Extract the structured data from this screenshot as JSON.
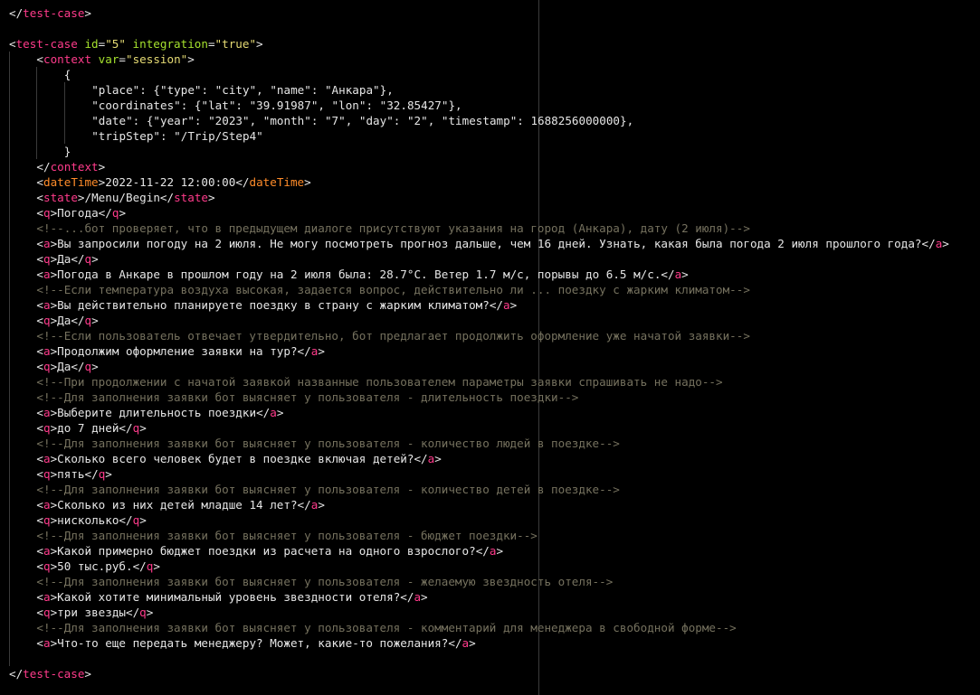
{
  "editor": {
    "colors": {
      "background": "#000000",
      "tag": "#ff3b8b",
      "element_name": "#ff8c2a",
      "attribute": "#a6e22e",
      "string": "#e6db74",
      "text": "#e6e6e6",
      "comment": "#75715e"
    },
    "lines": [
      {
        "indent": 0,
        "tokens": [
          {
            "k": "punct",
            "t": "</"
          },
          {
            "k": "tag",
            "t": "test-case"
          },
          {
            "k": "punct",
            "t": ">"
          }
        ]
      },
      {
        "indent": 0,
        "tokens": []
      },
      {
        "indent": 0,
        "tokens": [
          {
            "k": "punct",
            "t": "<"
          },
          {
            "k": "tag",
            "t": "test-case"
          },
          {
            "k": "text",
            "t": " "
          },
          {
            "k": "attr",
            "t": "id"
          },
          {
            "k": "punct",
            "t": "="
          },
          {
            "k": "str",
            "t": "\"5\""
          },
          {
            "k": "text",
            "t": " "
          },
          {
            "k": "attr",
            "t": "integration"
          },
          {
            "k": "punct",
            "t": "="
          },
          {
            "k": "str",
            "t": "\"true\""
          },
          {
            "k": "punct",
            "t": ">"
          }
        ]
      },
      {
        "indent": 1,
        "tokens": [
          {
            "k": "punct",
            "t": "<"
          },
          {
            "k": "tag",
            "t": "context"
          },
          {
            "k": "text",
            "t": " "
          },
          {
            "k": "attr",
            "t": "var"
          },
          {
            "k": "punct",
            "t": "="
          },
          {
            "k": "str",
            "t": "\"session\""
          },
          {
            "k": "punct",
            "t": ">"
          }
        ]
      },
      {
        "indent": 2,
        "tokens": [
          {
            "k": "text",
            "t": "{"
          }
        ]
      },
      {
        "indent": 3,
        "tokens": [
          {
            "k": "text",
            "t": "\"place\": {\"type\": \"city\", \"name\": \"Анкара\"},"
          }
        ]
      },
      {
        "indent": 3,
        "tokens": [
          {
            "k": "text",
            "t": "\"coordinates\": {\"lat\": \"39.91987\", \"lon\": \"32.85427\"},"
          }
        ]
      },
      {
        "indent": 3,
        "tokens": [
          {
            "k": "text",
            "t": "\"date\": {\"year\": \"2023\", \"month\": \"7\", \"day\": \"2\", \"timestamp\": 1688256000000},"
          }
        ]
      },
      {
        "indent": 3,
        "tokens": [
          {
            "k": "text",
            "t": "\"tripStep\": \"/Trip/Step4\""
          }
        ]
      },
      {
        "indent": 2,
        "tokens": [
          {
            "k": "text",
            "t": "}"
          }
        ]
      },
      {
        "indent": 1,
        "tokens": [
          {
            "k": "punct",
            "t": "</"
          },
          {
            "k": "tag",
            "t": "context"
          },
          {
            "k": "punct",
            "t": ">"
          }
        ]
      },
      {
        "indent": 1,
        "tokens": [
          {
            "k": "punct",
            "t": "<"
          },
          {
            "k": "name",
            "t": "dateTime"
          },
          {
            "k": "punct",
            "t": ">"
          },
          {
            "k": "text",
            "t": "2022-11-22 12:00:00"
          },
          {
            "k": "punct",
            "t": "</"
          },
          {
            "k": "name",
            "t": "dateTime"
          },
          {
            "k": "punct",
            "t": ">"
          }
        ]
      },
      {
        "indent": 1,
        "tokens": [
          {
            "k": "punct",
            "t": "<"
          },
          {
            "k": "tag",
            "t": "state"
          },
          {
            "k": "punct",
            "t": ">"
          },
          {
            "k": "text",
            "t": "/Menu/Begin"
          },
          {
            "k": "punct",
            "t": "</"
          },
          {
            "k": "tag",
            "t": "state"
          },
          {
            "k": "punct",
            "t": ">"
          }
        ]
      },
      {
        "indent": 1,
        "tokens": [
          {
            "k": "punct",
            "t": "<"
          },
          {
            "k": "tag",
            "t": "q"
          },
          {
            "k": "punct",
            "t": ">"
          },
          {
            "k": "text",
            "t": "Погода"
          },
          {
            "k": "punct",
            "t": "</"
          },
          {
            "k": "tag",
            "t": "q"
          },
          {
            "k": "punct",
            "t": ">"
          }
        ]
      },
      {
        "indent": 1,
        "tokens": [
          {
            "k": "comment",
            "t": "<!--...бот проверяет, что в предыдущем диалоге присутствуют указания на город (Анкара), дату (2 июля)-->"
          }
        ]
      },
      {
        "indent": 1,
        "tokens": [
          {
            "k": "punct",
            "t": "<"
          },
          {
            "k": "tag",
            "t": "a"
          },
          {
            "k": "punct",
            "t": ">"
          },
          {
            "k": "text",
            "t": "Вы запросили погоду на 2 июля. Не могу посмотреть прогноз дальше, чем 16 дней. Узнать, какая была погода 2 июля прошлого года?"
          },
          {
            "k": "punct",
            "t": "</"
          },
          {
            "k": "tag",
            "t": "a"
          },
          {
            "k": "punct",
            "t": ">"
          }
        ]
      },
      {
        "indent": 1,
        "tokens": [
          {
            "k": "punct",
            "t": "<"
          },
          {
            "k": "tag",
            "t": "q"
          },
          {
            "k": "punct",
            "t": ">"
          },
          {
            "k": "text",
            "t": "Да"
          },
          {
            "k": "punct",
            "t": "</"
          },
          {
            "k": "tag",
            "t": "q"
          },
          {
            "k": "punct",
            "t": ">"
          }
        ]
      },
      {
        "indent": 1,
        "tokens": [
          {
            "k": "punct",
            "t": "<"
          },
          {
            "k": "tag",
            "t": "a"
          },
          {
            "k": "punct",
            "t": ">"
          },
          {
            "k": "text",
            "t": "Погода в Анкаре в прошлом году на 2 июля была: 28.7°С. Ветер 1.7 м/с, порывы до 6.5 м/с."
          },
          {
            "k": "punct",
            "t": "</"
          },
          {
            "k": "tag",
            "t": "a"
          },
          {
            "k": "punct",
            "t": ">"
          }
        ]
      },
      {
        "indent": 1,
        "tokens": [
          {
            "k": "comment",
            "t": "<!--Если температура воздуха высокая, задается вопрос, действительно ли ... поездку с жарким климатом-->"
          }
        ]
      },
      {
        "indent": 1,
        "tokens": [
          {
            "k": "punct",
            "t": "<"
          },
          {
            "k": "tag",
            "t": "a"
          },
          {
            "k": "punct",
            "t": ">"
          },
          {
            "k": "text",
            "t": "Вы действительно планируете поездку в страну с жарким климатом?"
          },
          {
            "k": "punct",
            "t": "</"
          },
          {
            "k": "tag",
            "t": "a"
          },
          {
            "k": "punct",
            "t": ">"
          }
        ]
      },
      {
        "indent": 1,
        "tokens": [
          {
            "k": "punct",
            "t": "<"
          },
          {
            "k": "tag",
            "t": "q"
          },
          {
            "k": "punct",
            "t": ">"
          },
          {
            "k": "text",
            "t": "Да"
          },
          {
            "k": "punct",
            "t": "</"
          },
          {
            "k": "tag",
            "t": "q"
          },
          {
            "k": "punct",
            "t": ">"
          }
        ]
      },
      {
        "indent": 1,
        "tokens": [
          {
            "k": "comment",
            "t": "<!--Если пользователь отвечает утвердительно, бот предлагает продолжить оформление уже начатой заявки-->"
          }
        ]
      },
      {
        "indent": 1,
        "tokens": [
          {
            "k": "punct",
            "t": "<"
          },
          {
            "k": "tag",
            "t": "a"
          },
          {
            "k": "punct",
            "t": ">"
          },
          {
            "k": "text",
            "t": "Продолжим оформление заявки на тур?"
          },
          {
            "k": "punct",
            "t": "</"
          },
          {
            "k": "tag",
            "t": "a"
          },
          {
            "k": "punct",
            "t": ">"
          }
        ]
      },
      {
        "indent": 1,
        "tokens": [
          {
            "k": "punct",
            "t": "<"
          },
          {
            "k": "tag",
            "t": "q"
          },
          {
            "k": "punct",
            "t": ">"
          },
          {
            "k": "text",
            "t": "Да"
          },
          {
            "k": "punct",
            "t": "</"
          },
          {
            "k": "tag",
            "t": "q"
          },
          {
            "k": "punct",
            "t": ">"
          }
        ]
      },
      {
        "indent": 1,
        "tokens": [
          {
            "k": "comment",
            "t": "<!--При продолжении с начатой заявкой названные пользователем параметры заявки спрашивать не надо-->"
          }
        ]
      },
      {
        "indent": 1,
        "tokens": [
          {
            "k": "comment",
            "t": "<!--Для заполнения заявки бот выясняет у пользователя - длительность поездки-->"
          }
        ]
      },
      {
        "indent": 1,
        "tokens": [
          {
            "k": "punct",
            "t": "<"
          },
          {
            "k": "tag",
            "t": "a"
          },
          {
            "k": "punct",
            "t": ">"
          },
          {
            "k": "text",
            "t": "Выберите длительность поездки"
          },
          {
            "k": "punct",
            "t": "</"
          },
          {
            "k": "tag",
            "t": "a"
          },
          {
            "k": "punct",
            "t": ">"
          }
        ]
      },
      {
        "indent": 1,
        "tokens": [
          {
            "k": "punct",
            "t": "<"
          },
          {
            "k": "tag",
            "t": "q"
          },
          {
            "k": "punct",
            "t": ">"
          },
          {
            "k": "text",
            "t": "до 7 дней"
          },
          {
            "k": "punct",
            "t": "</"
          },
          {
            "k": "tag",
            "t": "q"
          },
          {
            "k": "punct",
            "t": ">"
          }
        ]
      },
      {
        "indent": 1,
        "tokens": [
          {
            "k": "comment",
            "t": "<!--Для заполнения заявки бот выясняет у пользователя - количество людей в поездке-->"
          }
        ]
      },
      {
        "indent": 1,
        "tokens": [
          {
            "k": "punct",
            "t": "<"
          },
          {
            "k": "tag",
            "t": "a"
          },
          {
            "k": "punct",
            "t": ">"
          },
          {
            "k": "text",
            "t": "Сколько всего человек будет в поездке включая детей?"
          },
          {
            "k": "punct",
            "t": "</"
          },
          {
            "k": "tag",
            "t": "a"
          },
          {
            "k": "punct",
            "t": ">"
          }
        ]
      },
      {
        "indent": 1,
        "tokens": [
          {
            "k": "punct",
            "t": "<"
          },
          {
            "k": "tag",
            "t": "q"
          },
          {
            "k": "punct",
            "t": ">"
          },
          {
            "k": "text",
            "t": "пять"
          },
          {
            "k": "punct",
            "t": "</"
          },
          {
            "k": "tag",
            "t": "q"
          },
          {
            "k": "punct",
            "t": ">"
          }
        ]
      },
      {
        "indent": 1,
        "tokens": [
          {
            "k": "comment",
            "t": "<!--Для заполнения заявки бот выясняет у пользователя - количество детей в поездке-->"
          }
        ]
      },
      {
        "indent": 1,
        "tokens": [
          {
            "k": "punct",
            "t": "<"
          },
          {
            "k": "tag",
            "t": "a"
          },
          {
            "k": "punct",
            "t": ">"
          },
          {
            "k": "text",
            "t": "Сколько из них детей младше 14 лет?"
          },
          {
            "k": "punct",
            "t": "</"
          },
          {
            "k": "tag",
            "t": "a"
          },
          {
            "k": "punct",
            "t": ">"
          }
        ]
      },
      {
        "indent": 1,
        "tokens": [
          {
            "k": "punct",
            "t": "<"
          },
          {
            "k": "tag",
            "t": "q"
          },
          {
            "k": "punct",
            "t": ">"
          },
          {
            "k": "text",
            "t": "нисколько"
          },
          {
            "k": "punct",
            "t": "</"
          },
          {
            "k": "tag",
            "t": "q"
          },
          {
            "k": "punct",
            "t": ">"
          }
        ]
      },
      {
        "indent": 1,
        "tokens": [
          {
            "k": "comment",
            "t": "<!--Для заполнения заявки бот выясняет у пользователя - бюджет поездки-->"
          }
        ]
      },
      {
        "indent": 1,
        "tokens": [
          {
            "k": "punct",
            "t": "<"
          },
          {
            "k": "tag",
            "t": "a"
          },
          {
            "k": "punct",
            "t": ">"
          },
          {
            "k": "text",
            "t": "Какой примерно бюджет поездки из расчета на одного взрослого?"
          },
          {
            "k": "punct",
            "t": "</"
          },
          {
            "k": "tag",
            "t": "a"
          },
          {
            "k": "punct",
            "t": ">"
          }
        ]
      },
      {
        "indent": 1,
        "tokens": [
          {
            "k": "punct",
            "t": "<"
          },
          {
            "k": "tag",
            "t": "q"
          },
          {
            "k": "punct",
            "t": ">"
          },
          {
            "k": "text",
            "t": "50 тыс.руб."
          },
          {
            "k": "punct",
            "t": "</"
          },
          {
            "k": "tag",
            "t": "q"
          },
          {
            "k": "punct",
            "t": ">"
          }
        ]
      },
      {
        "indent": 1,
        "tokens": [
          {
            "k": "comment",
            "t": "<!--Для заполнения заявки бот выясняет у пользователя - желаемую звездность отеля-->"
          }
        ]
      },
      {
        "indent": 1,
        "tokens": [
          {
            "k": "punct",
            "t": "<"
          },
          {
            "k": "tag",
            "t": "a"
          },
          {
            "k": "punct",
            "t": ">"
          },
          {
            "k": "text",
            "t": "Какой хотите минимальный уровень звездности отеля?"
          },
          {
            "k": "punct",
            "t": "</"
          },
          {
            "k": "tag",
            "t": "a"
          },
          {
            "k": "punct",
            "t": ">"
          }
        ]
      },
      {
        "indent": 1,
        "tokens": [
          {
            "k": "punct",
            "t": "<"
          },
          {
            "k": "tag",
            "t": "q"
          },
          {
            "k": "punct",
            "t": ">"
          },
          {
            "k": "text",
            "t": "три звезды"
          },
          {
            "k": "punct",
            "t": "</"
          },
          {
            "k": "tag",
            "t": "q"
          },
          {
            "k": "punct",
            "t": ">"
          }
        ]
      },
      {
        "indent": 1,
        "tokens": [
          {
            "k": "comment",
            "t": "<!--Для заполнения заявки бот выясняет у пользователя - комментарий для менеджера в свободной форме-->"
          }
        ]
      },
      {
        "indent": 1,
        "tokens": [
          {
            "k": "punct",
            "t": "<"
          },
          {
            "k": "tag",
            "t": "a"
          },
          {
            "k": "punct",
            "t": ">"
          },
          {
            "k": "text",
            "t": "Что-то еще передать менеджеру? Может, какие-то пожелания?"
          },
          {
            "k": "punct",
            "t": "</"
          },
          {
            "k": "tag",
            "t": "a"
          },
          {
            "k": "punct",
            "t": ">"
          }
        ]
      },
      {
        "indent": 1,
        "tokens": []
      },
      {
        "indent": 0,
        "tokens": [
          {
            "k": "punct",
            "t": "</"
          },
          {
            "k": "tag",
            "t": "test-case"
          },
          {
            "k": "punct",
            "t": ">"
          }
        ]
      }
    ]
  }
}
